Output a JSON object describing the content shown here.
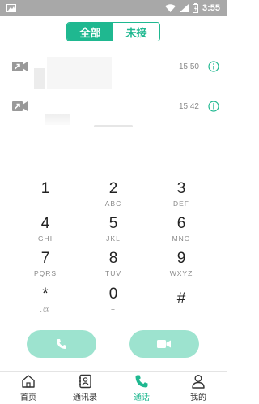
{
  "status_bar": {
    "time": "3:55"
  },
  "segment": {
    "tabs": [
      {
        "label": "全部",
        "active": true
      },
      {
        "label": "未接",
        "active": false
      }
    ]
  },
  "calls": [
    {
      "time": "15:50"
    },
    {
      "time": "15:42"
    }
  ],
  "keypad": [
    {
      "digit": "1",
      "letters": ""
    },
    {
      "digit": "2",
      "letters": "ABC"
    },
    {
      "digit": "3",
      "letters": "DEF"
    },
    {
      "digit": "4",
      "letters": "GHI"
    },
    {
      "digit": "5",
      "letters": "JKL"
    },
    {
      "digit": "6",
      "letters": "MNO"
    },
    {
      "digit": "7",
      "letters": "PQRS"
    },
    {
      "digit": "8",
      "letters": "TUV"
    },
    {
      "digit": "9",
      "letters": "WXYZ"
    },
    {
      "digit": "*",
      "letters": ".@"
    },
    {
      "digit": "0",
      "letters": "+"
    },
    {
      "digit": "#",
      "letters": ""
    }
  ],
  "bottom_nav": [
    {
      "label": "首页",
      "icon": "home-icon",
      "active": false
    },
    {
      "label": "通讯录",
      "icon": "contacts-icon",
      "active": false
    },
    {
      "label": "通话",
      "icon": "phone-icon",
      "active": true
    },
    {
      "label": "我的",
      "icon": "profile-icon",
      "active": false
    }
  ],
  "colors": {
    "accent": "#1fb890",
    "button_bg": "#9de3cf",
    "status_bar": "#a8a8a8"
  }
}
